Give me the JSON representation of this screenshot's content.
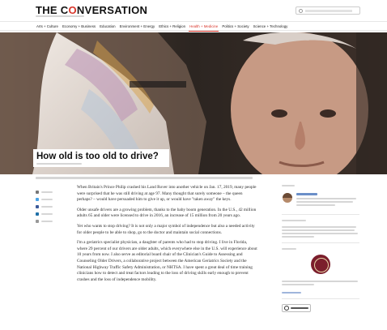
{
  "header": {
    "logo_prefix": "THE C",
    "logo_accent": "O",
    "logo_suffix": "NVERSATION"
  },
  "nav": {
    "items": [
      {
        "label": "Arts + Culture"
      },
      {
        "label": "Economy + Business"
      },
      {
        "label": "Education"
      },
      {
        "label": "Environment + Energy"
      },
      {
        "label": "Ethics + Religion"
      },
      {
        "label": "Health + Medicine"
      },
      {
        "label": "Politics + Society"
      },
      {
        "label": "Science + Technology"
      }
    ],
    "active_index": 5
  },
  "article": {
    "title": "How old is too old to drive?",
    "paragraphs": [
      "When Britain's Prince Philip crashed his Land Rover into another vehicle on Jan. 17, 2019, many people were surprised that he was still driving at age 97. Many thought that surely someone – the queen perhaps? – would have persuaded him to give it up, or would have \"taken away\" the keys.",
      "Older unsafe drivers are a growing problem, thanks to the baby boom generation. In the U.S., 42 million adults 65 and older were licensed to drive in 2016, an increase of 15 million from 20 years ago.",
      "Yet who wants to stop driving? It is not only a major symbol of independence but also a needed activity for older people to be able to shop, go to the doctor and maintain social connections.",
      "I'm a geriatrics specialist physician, a daughter of parents who had to stop driving. I live in Florida, where 29 percent of our drivers are older adults, which everywhere else in the U.S. will experience about 10 years from now. I also serve as editorial board chair of the Clinician's Guide to Assessing and Counseling Older Drivers, a collaborative project between the American Geriatrics Society and the National Highway Traffic Safety Administration, or NHTSA. I have spent a great deal of time training clinicians how to detect and treat factors leading to the loss of driving skills early enough to prevent crashes and the loss of independence mobility."
    ]
  },
  "colors": {
    "accent": "#d8352a",
    "link": "#6b8fc8"
  }
}
